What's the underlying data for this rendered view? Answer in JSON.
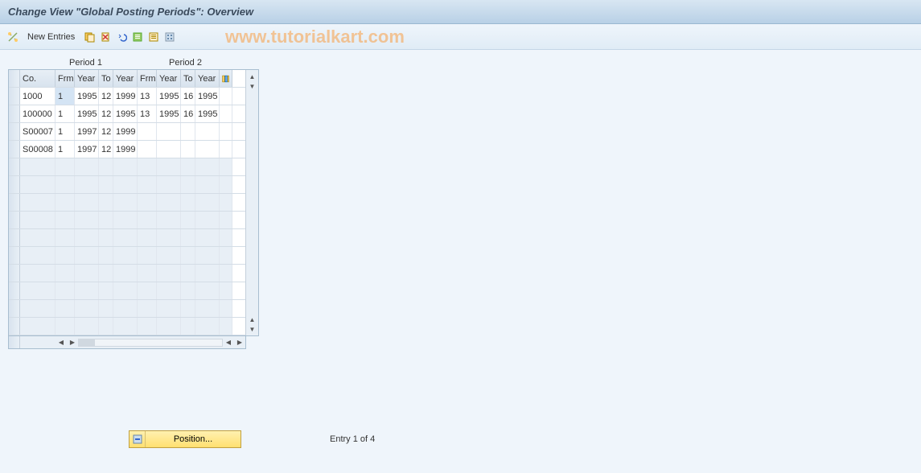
{
  "title": "Change View \"Global Posting Periods\": Overview",
  "toolbar": {
    "new_entries_label": "New Entries"
  },
  "watermark": "www.tutorialkart.com",
  "period_headers": {
    "p1": "Period 1",
    "p2": "Period 2"
  },
  "columns": [
    "Co.",
    "Frm",
    "Year",
    "To",
    "Year",
    "Frm",
    "Year",
    "To",
    "Year"
  ],
  "rows": [
    {
      "co": "1000",
      "frm1": "1",
      "y1": "1995",
      "to1": "12",
      "y2": "1999",
      "frm2": "13",
      "y3": "1995",
      "to2": "16",
      "y4": "1995"
    },
    {
      "co": "100000",
      "frm1": "1",
      "y1": "1995",
      "to1": "12",
      "y2": "1995",
      "frm2": "13",
      "y3": "1995",
      "to2": "16",
      "y4": "1995"
    },
    {
      "co": "S00007",
      "frm1": "1",
      "y1": "1997",
      "to1": "12",
      "y2": "1999",
      "frm2": "",
      "y3": "",
      "to2": "",
      "y4": ""
    },
    {
      "co": "S00008",
      "frm1": "1",
      "y1": "1997",
      "to1": "12",
      "y2": "1999",
      "frm2": "",
      "y3": "",
      "to2": "",
      "y4": ""
    }
  ],
  "position_btn": "Position...",
  "entry_status": "Entry 1 of 4",
  "colors": {
    "header_bg1": "#d8e6f2",
    "header_bg2": "#b8d0e6",
    "toolbar_bg": "#eff5fb"
  }
}
